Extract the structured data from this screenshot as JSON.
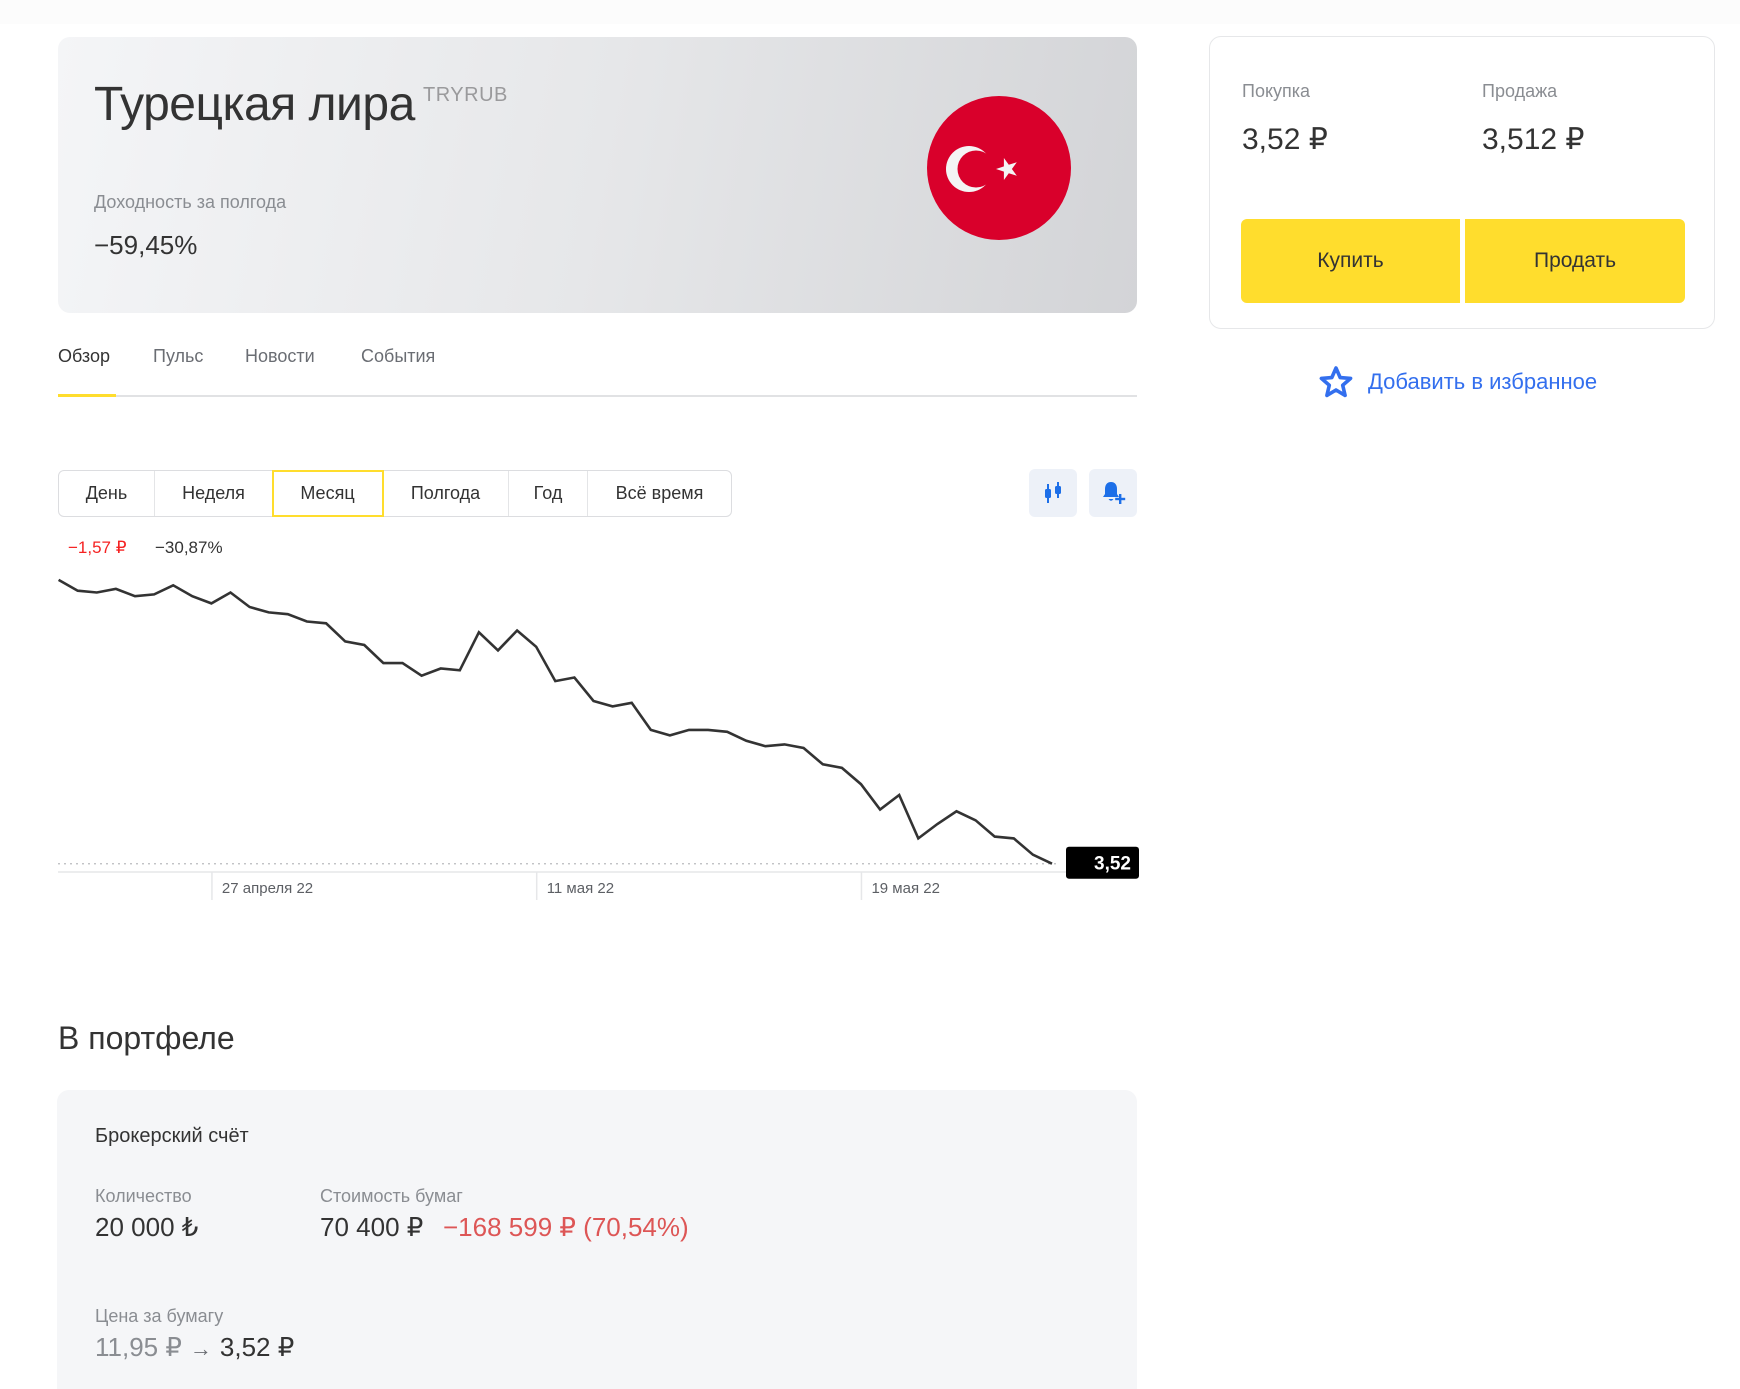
{
  "instrument": {
    "name": "Турецкая лира",
    "ticker": "TRYRUB",
    "yield_label": "Доходность за полгода",
    "yield_value": "−59,45%",
    "flag_icon": "turkey-flag-icon"
  },
  "tabs": [
    {
      "label": "Обзор",
      "active": true
    },
    {
      "label": "Пульс",
      "active": false
    },
    {
      "label": "Новости",
      "active": false
    },
    {
      "label": "События",
      "active": false
    }
  ],
  "periods": [
    {
      "label": "День",
      "active": false
    },
    {
      "label": "Неделя",
      "active": false
    },
    {
      "label": "Месяц",
      "active": true
    },
    {
      "label": "Полгода",
      "active": false
    },
    {
      "label": "Год",
      "active": false
    },
    {
      "label": "Всё время",
      "active": false
    }
  ],
  "chart_tools": {
    "candles_icon": "candlestick-chart-icon",
    "alert_icon": "bell-plus-icon"
  },
  "chart_summary": {
    "change_abs": "−1,57 ₽",
    "change_pct": "−30,87%",
    "last_price_label": "3,52"
  },
  "chart_data": {
    "type": "line",
    "title": "",
    "xlabel": "",
    "ylabel": "",
    "series": [
      {
        "name": "TRYRUB",
        "values": [
          5.09,
          5.03,
          5.02,
          5.04,
          5.0,
          5.01,
          5.06,
          5.0,
          4.96,
          5.02,
          4.94,
          4.91,
          4.9,
          4.86,
          4.85,
          4.75,
          4.73,
          4.63,
          4.63,
          4.56,
          4.6,
          4.59,
          4.8,
          4.7,
          4.81,
          4.72,
          4.53,
          4.55,
          4.42,
          4.39,
          4.41,
          4.26,
          4.23,
          4.26,
          4.26,
          4.25,
          4.2,
          4.17,
          4.18,
          4.16,
          4.07,
          4.05,
          3.96,
          3.82,
          3.9,
          3.66,
          3.74,
          3.81,
          3.76,
          3.67,
          3.66,
          3.57,
          3.52
        ]
      }
    ],
    "x_ticks": [
      {
        "index": 8,
        "label": "27 апреля 22"
      },
      {
        "index": 25,
        "label": "11 мая 22"
      },
      {
        "index": 42,
        "label": "19 мая 22"
      }
    ],
    "ylim": [
      3.43,
      5.2
    ],
    "last_value": 3.52,
    "reference_line": {
      "value": 3.52,
      "style": "dotted"
    },
    "grid": false,
    "legend": "none"
  },
  "portfolio": {
    "title": "В портфеле",
    "account": "Брокерский счёт",
    "quantity_label": "Количество",
    "quantity_value": "20 000 ₺",
    "value_label": "Стоимость бумаг",
    "value_amount": "70 400 ₽",
    "value_change": "−168 599 ₽ (70,54%)",
    "price_label": "Цена за бумагу",
    "price_old": "11,95 ₽",
    "price_arrow": "→",
    "price_new": "3,52 ₽"
  },
  "trade": {
    "buy_label": "Покупка",
    "buy_price": "3,52 ₽",
    "sell_label": "Продажа",
    "sell_price": "3,512 ₽",
    "buy_button": "Купить",
    "sell_button": "Продать"
  },
  "favorite": {
    "label": "Добавить в избранное",
    "icon": "star-icon"
  },
  "colors": {
    "accent_yellow": "#ffdd2d",
    "link_blue": "#336fee",
    "loss_red": "#dd5656",
    "chart_change_red": "#f52222",
    "flag_red": "#d9002b"
  }
}
